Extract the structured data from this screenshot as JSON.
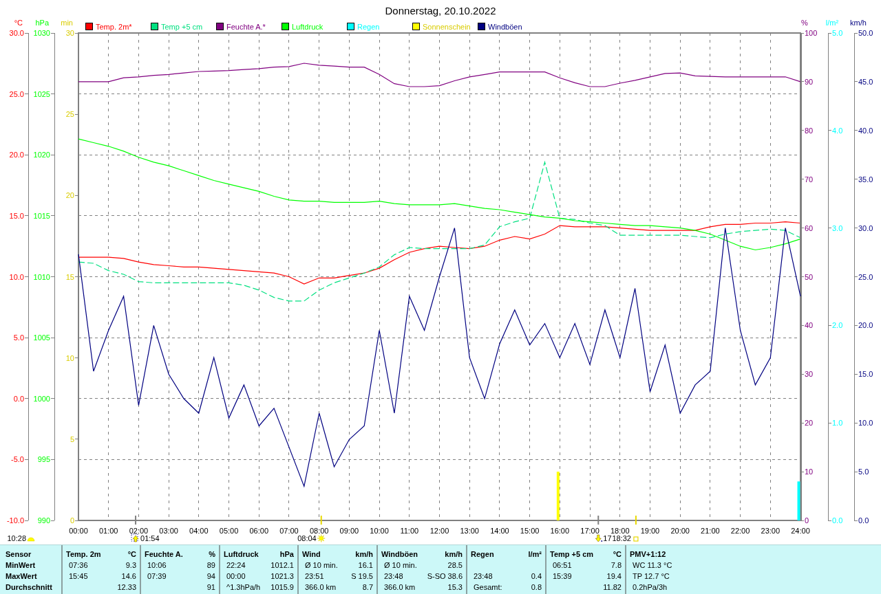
{
  "title": "Donnerstag, 20.10.2022",
  "legend": [
    {
      "label": "Temp. 2m*",
      "color": "#ff0000"
    },
    {
      "label": "Temp +5 cm",
      "color": "#00e080"
    },
    {
      "label": "Feuchte A.*",
      "color": "#800080"
    },
    {
      "label": "Luftdruck",
      "color": "#00ff00"
    },
    {
      "label": "Regen",
      "color": "#00ffff"
    },
    {
      "label": "Sonnenschein",
      "color": "#ffff00"
    },
    {
      "label": "Windböen",
      "color": "#000080"
    }
  ],
  "moon_phase": {
    "label": "10:28"
  },
  "left_chart": {
    "event_kinds": [
      {
        "kind": "moonrise"
      },
      {
        "kind": "sunrise"
      },
      {
        "kind": "moonset"
      },
      {
        "kind": "sunset"
      }
    ],
    "chart_data": {
      "type": "line",
      "xlim": [
        0,
        24
      ],
      "x": [
        0,
        0.5,
        1,
        1.5,
        2,
        2.5,
        3,
        3.5,
        4,
        4.5,
        5,
        5.5,
        6,
        6.5,
        7,
        7.5,
        8,
        8.5,
        9,
        9.5,
        10,
        10.5,
        11,
        11.5,
        12,
        12.5,
        13,
        13.5,
        14,
        14.5,
        15,
        15.5,
        16,
        16.5,
        17,
        17.5,
        18,
        18.5,
        19,
        19.5,
        20,
        20.5,
        21,
        21.5,
        22,
        22.5,
        23,
        23.5,
        24
      ],
      "xticks": [
        {
          "value": 0,
          "label": "00:00"
        },
        {
          "value": 1,
          "label": "01:00"
        },
        {
          "value": 2,
          "label": "02:00"
        },
        {
          "value": 3,
          "label": "03:00"
        },
        {
          "value": 4,
          "label": "04:00"
        },
        {
          "value": 5,
          "label": "05:00"
        },
        {
          "value": 6,
          "label": "06:00"
        },
        {
          "value": 7,
          "label": "07:00"
        },
        {
          "value": 8,
          "label": "08:00"
        },
        {
          "value": 9,
          "label": "09:00"
        },
        {
          "value": 10,
          "label": "10:00"
        },
        {
          "value": 11,
          "label": "11:00"
        },
        {
          "value": 12,
          "label": "12:00"
        },
        {
          "value": 13,
          "label": "13:00"
        },
        {
          "value": 14,
          "label": "14:00"
        },
        {
          "value": 15,
          "label": "15:00"
        },
        {
          "value": 16,
          "label": "16:00"
        },
        {
          "value": 17,
          "label": "17:00"
        },
        {
          "value": 18,
          "label": "18:00"
        },
        {
          "value": 19,
          "label": "19:00"
        },
        {
          "value": 20,
          "label": "20:00"
        },
        {
          "value": 21,
          "label": "21:00"
        },
        {
          "value": 22,
          "label": "22:00"
        },
        {
          "value": 23,
          "label": "23:00"
        },
        {
          "value": 24,
          "label": "24:00"
        }
      ],
      "ylabel": "°C",
      "ylim": [
        -10,
        30
      ],
      "yticks": [
        {
          "value": 30,
          "label": "30.0"
        },
        {
          "value": 25,
          "label": "25.0"
        },
        {
          "value": 20,
          "label": "20.0"
        },
        {
          "value": 15,
          "label": "15.0"
        },
        {
          "value": 10,
          "label": "10.0"
        },
        {
          "value": 5,
          "label": "5.0"
        },
        {
          "value": 0,
          "label": "0.0"
        },
        {
          "value": -5,
          "label": "-5.0"
        },
        {
          "value": -10,
          "label": "-10.0"
        }
      ],
      "y2label": "hPa",
      "y2lim": [
        990,
        1030
      ],
      "y2ticks": [
        1030,
        1025,
        1020,
        1015,
        1010,
        1005,
        1000,
        995,
        990
      ],
      "y3label": "min",
      "y3lim": [
        0,
        30
      ],
      "y3ticks": [
        30,
        25,
        20,
        15,
        10,
        5,
        0
      ],
      "series": [
        {
          "color": "#ff0000",
          "values": [
            11.6,
            11.6,
            11.6,
            11.5,
            11.2,
            11.0,
            10.9,
            10.8,
            10.8,
            10.7,
            10.6,
            10.5,
            10.4,
            10.3,
            10.0,
            9.4,
            9.9,
            9.9,
            10.1,
            10.3,
            10.7,
            11.4,
            12.0,
            12.3,
            12.5,
            12.4,
            12.3,
            12.5,
            13.0,
            13.3,
            13.1,
            13.5,
            14.2,
            14.1,
            14.1,
            14.1,
            14.0,
            13.9,
            13.8,
            13.8,
            13.8,
            13.8,
            14.1,
            14.3,
            14.3,
            14.4,
            14.4,
            14.5,
            14.4
          ]
        },
        {
          "color": "#00e080",
          "line_style": "dashed",
          "values": [
            11.2,
            11.1,
            10.5,
            10.2,
            9.6,
            9.5,
            9.5,
            9.5,
            9.5,
            9.5,
            9.5,
            9.3,
            8.9,
            8.3,
            8.0,
            8.0,
            8.9,
            9.5,
            9.9,
            10.3,
            10.8,
            11.8,
            12.4,
            12.3,
            12.3,
            12.3,
            12.3,
            12.6,
            14.1,
            14.5,
            14.8,
            19.4,
            14.8,
            14.7,
            14.4,
            14.2,
            13.4,
            13.4,
            13.4,
            13.4,
            13.4,
            13.3,
            13.2,
            13.5,
            13.7,
            13.8,
            13.9,
            13.8,
            13.2
          ]
        },
        {
          "axis": "y2",
          "color": "#00ff00",
          "values": [
            1021.3,
            1021.0,
            1020.7,
            1020.3,
            1019.8,
            1019.4,
            1019.1,
            1018.7,
            1018.3,
            1017.9,
            1017.6,
            1017.3,
            1017.0,
            1016.6,
            1016.3,
            1016.2,
            1016.2,
            1016.1,
            1016.1,
            1016.1,
            1016.2,
            1016.0,
            1015.9,
            1015.9,
            1015.9,
            1016.0,
            1015.8,
            1015.6,
            1015.5,
            1015.3,
            1015.1,
            1014.9,
            1014.8,
            1014.6,
            1014.5,
            1014.4,
            1014.3,
            1014.2,
            1014.2,
            1014.1,
            1014.0,
            1013.8,
            1013.5,
            1013.0,
            1012.5,
            1012.2,
            1012.4,
            1012.7,
            1013.1
          ]
        },
        {
          "axis": "y3",
          "type": "bar",
          "color": "#ffff00",
          "values": [
            0,
            0,
            0,
            0,
            0,
            0,
            0,
            0,
            0,
            0,
            0,
            0,
            0,
            0,
            0,
            0,
            0,
            0,
            0,
            0,
            0,
            0,
            0,
            0,
            0,
            0,
            0,
            0,
            0,
            0,
            0,
            0,
            3,
            0,
            0,
            0,
            0,
            0,
            0,
            0,
            0,
            0,
            0,
            0,
            0,
            0,
            0,
            0,
            0
          ]
        }
      ],
      "annotations": [
        "01:54",
        "08:04",
        "17",
        "18:32"
      ]
    }
  },
  "right_chart": {
    "chart_data": {
      "type": "line",
      "xlim": [
        0,
        24
      ],
      "x": [
        0,
        0.5,
        1,
        1.5,
        2,
        2.5,
        3,
        3.5,
        4,
        4.5,
        5,
        5.5,
        6,
        6.5,
        7,
        7.5,
        8,
        8.5,
        9,
        9.5,
        10,
        10.5,
        11,
        11.5,
        12,
        12.5,
        13,
        13.5,
        14,
        14.5,
        15,
        15.5,
        16,
        16.5,
        17,
        17.5,
        18,
        18.5,
        19,
        19.5,
        20,
        20.5,
        21,
        21.5,
        22,
        22.5,
        23,
        23.5,
        24
      ],
      "ylabel": "%",
      "ylim": [
        0,
        100
      ],
      "yticks": [
        100,
        90,
        80,
        70,
        60,
        50,
        40,
        30,
        20,
        10,
        0
      ],
      "y2label": "l/m²",
      "y2lim": [
        0,
        5
      ],
      "y2ticks": [
        {
          "value": 5,
          "label": "5.0"
        },
        {
          "value": 4,
          "label": "4.0"
        },
        {
          "value": 3,
          "label": "3.0"
        },
        {
          "value": 2,
          "label": "2.0"
        },
        {
          "value": 1,
          "label": "1.0"
        },
        {
          "value": 0,
          "label": "0.0"
        }
      ],
      "y3label": "km/h",
      "y3lim": [
        0,
        50
      ],
      "y3ticks": [
        {
          "value": 50,
          "label": "50.0"
        },
        {
          "value": 45,
          "label": "45.0"
        },
        {
          "value": 40,
          "label": "40.0"
        },
        {
          "value": 35,
          "label": "35.0"
        },
        {
          "value": 30,
          "label": "30.0"
        },
        {
          "value": 25,
          "label": "25.0"
        },
        {
          "value": 20,
          "label": "20.0"
        },
        {
          "value": 15,
          "label": "15.0"
        },
        {
          "value": 10,
          "label": "10.0"
        },
        {
          "value": 5,
          "label": "5.0"
        },
        {
          "value": 0,
          "label": "0.0"
        }
      ],
      "series": [
        {
          "color": "#800080",
          "values": [
            90.0,
            90.0,
            90.0,
            90.8,
            91.0,
            91.3,
            91.5,
            91.8,
            92.1,
            92.2,
            92.3,
            92.5,
            92.7,
            93.0,
            93.1,
            93.8,
            93.4,
            93.2,
            93.0,
            93.0,
            91.5,
            89.6,
            89.0,
            89.0,
            89.2,
            90.2,
            91.0,
            91.5,
            92.0,
            92.0,
            92.0,
            92.0,
            90.8,
            89.8,
            89.0,
            89.0,
            89.7,
            90.3,
            91.0,
            91.7,
            91.8,
            91.2,
            91.1,
            91.0,
            91.0,
            91.0,
            91.0,
            91.0,
            90.0
          ]
        },
        {
          "axis": "y2",
          "type": "bar",
          "color": "#00ffff",
          "values": [
            0,
            0,
            0,
            0,
            0,
            0,
            0,
            0,
            0,
            0,
            0,
            0,
            0,
            0,
            0,
            0,
            0,
            0,
            0,
            0,
            0,
            0,
            0,
            0,
            0,
            0,
            0,
            0,
            0,
            0,
            0,
            0,
            0,
            0,
            0,
            0,
            0,
            0,
            0,
            0,
            0,
            0,
            0,
            0,
            0,
            0,
            0,
            0,
            0.4
          ]
        },
        {
          "axis": "y3",
          "color": "#000080",
          "values": [
            27.3,
            15.3,
            19.5,
            23.0,
            11.8,
            20.0,
            15.0,
            12.5,
            11.0,
            16.7,
            10.5,
            13.9,
            9.7,
            11.5,
            7.5,
            3.5,
            11.0,
            5.5,
            8.3,
            9.7,
            19.5,
            11.0,
            23.0,
            19.5,
            25.0,
            30.0,
            16.7,
            12.5,
            18.1,
            21.6,
            18.0,
            20.2,
            16.7,
            20.2,
            16.0,
            21.6,
            16.7,
            23.8,
            13.2,
            18.0,
            11.0,
            13.9,
            15.3,
            30.0,
            19.5,
            13.9,
            16.7,
            30.0,
            23.0
          ]
        }
      ]
    }
  },
  "stats": {
    "row_labels": [
      "Sensor",
      "MinWert",
      "MaxWert",
      "Durchschnitt"
    ],
    "groups": [
      {
        "name": "Temp. 2m",
        "unit": "°C",
        "rows": [
          {
            "label": "07:36",
            "value": "9.3"
          },
          {
            "label": "15:45",
            "value": "14.6"
          },
          {
            "value": "12.33"
          }
        ]
      },
      {
        "name": "Feuchte A.",
        "unit": "%",
        "rows": [
          {
            "label": "10:06",
            "value": "89"
          },
          {
            "label": "07:39",
            "value": "94"
          },
          {
            "value": "91"
          }
        ]
      },
      {
        "name": "Luftdruck",
        "unit": "hPa",
        "rows": [
          {
            "label": "22:24",
            "value": "1012.1"
          },
          {
            "label": "00:00",
            "value": "1021.3"
          },
          {
            "label": "^1.3hPa/h",
            "value": "1015.9"
          }
        ]
      },
      {
        "name": "Wind",
        "unit": "km/h",
        "rows": [
          {
            "label": "Ø 10 min.",
            "value": "16.1"
          },
          {
            "label": "23:51",
            "value": "S 19.5"
          },
          {
            "label": "366.0 km",
            "value": "8.7"
          }
        ]
      },
      {
        "name": "Windböen",
        "unit": "km/h",
        "rows": [
          {
            "label": "Ø 10 min.",
            "value": "28.5"
          },
          {
            "label": "23:48",
            "value": "S-SO 38.6"
          },
          {
            "label": "366.0 km",
            "value": "15.3"
          }
        ]
      },
      {
        "name": "Regen",
        "unit": "l/m²",
        "rows": [
          {},
          {
            "label": "23:48",
            "value": "0.4"
          },
          {
            "label": "Gesamt:",
            "value": "0.8"
          }
        ]
      },
      {
        "name": "Temp +5 cm",
        "unit": "°C",
        "rows": [
          {
            "label": "06:51",
            "value": "7.8"
          },
          {
            "label": "15:39",
            "value": "19.4"
          },
          {
            "value": "11.82"
          }
        ]
      },
      {
        "name": "PMV+1:12",
        "rows": [
          {
            "label": "WC 11.3 °C"
          },
          {
            "label": "TP 12.7 °C"
          },
          {
            "label": "0.2hPa/3h"
          }
        ]
      }
    ]
  }
}
